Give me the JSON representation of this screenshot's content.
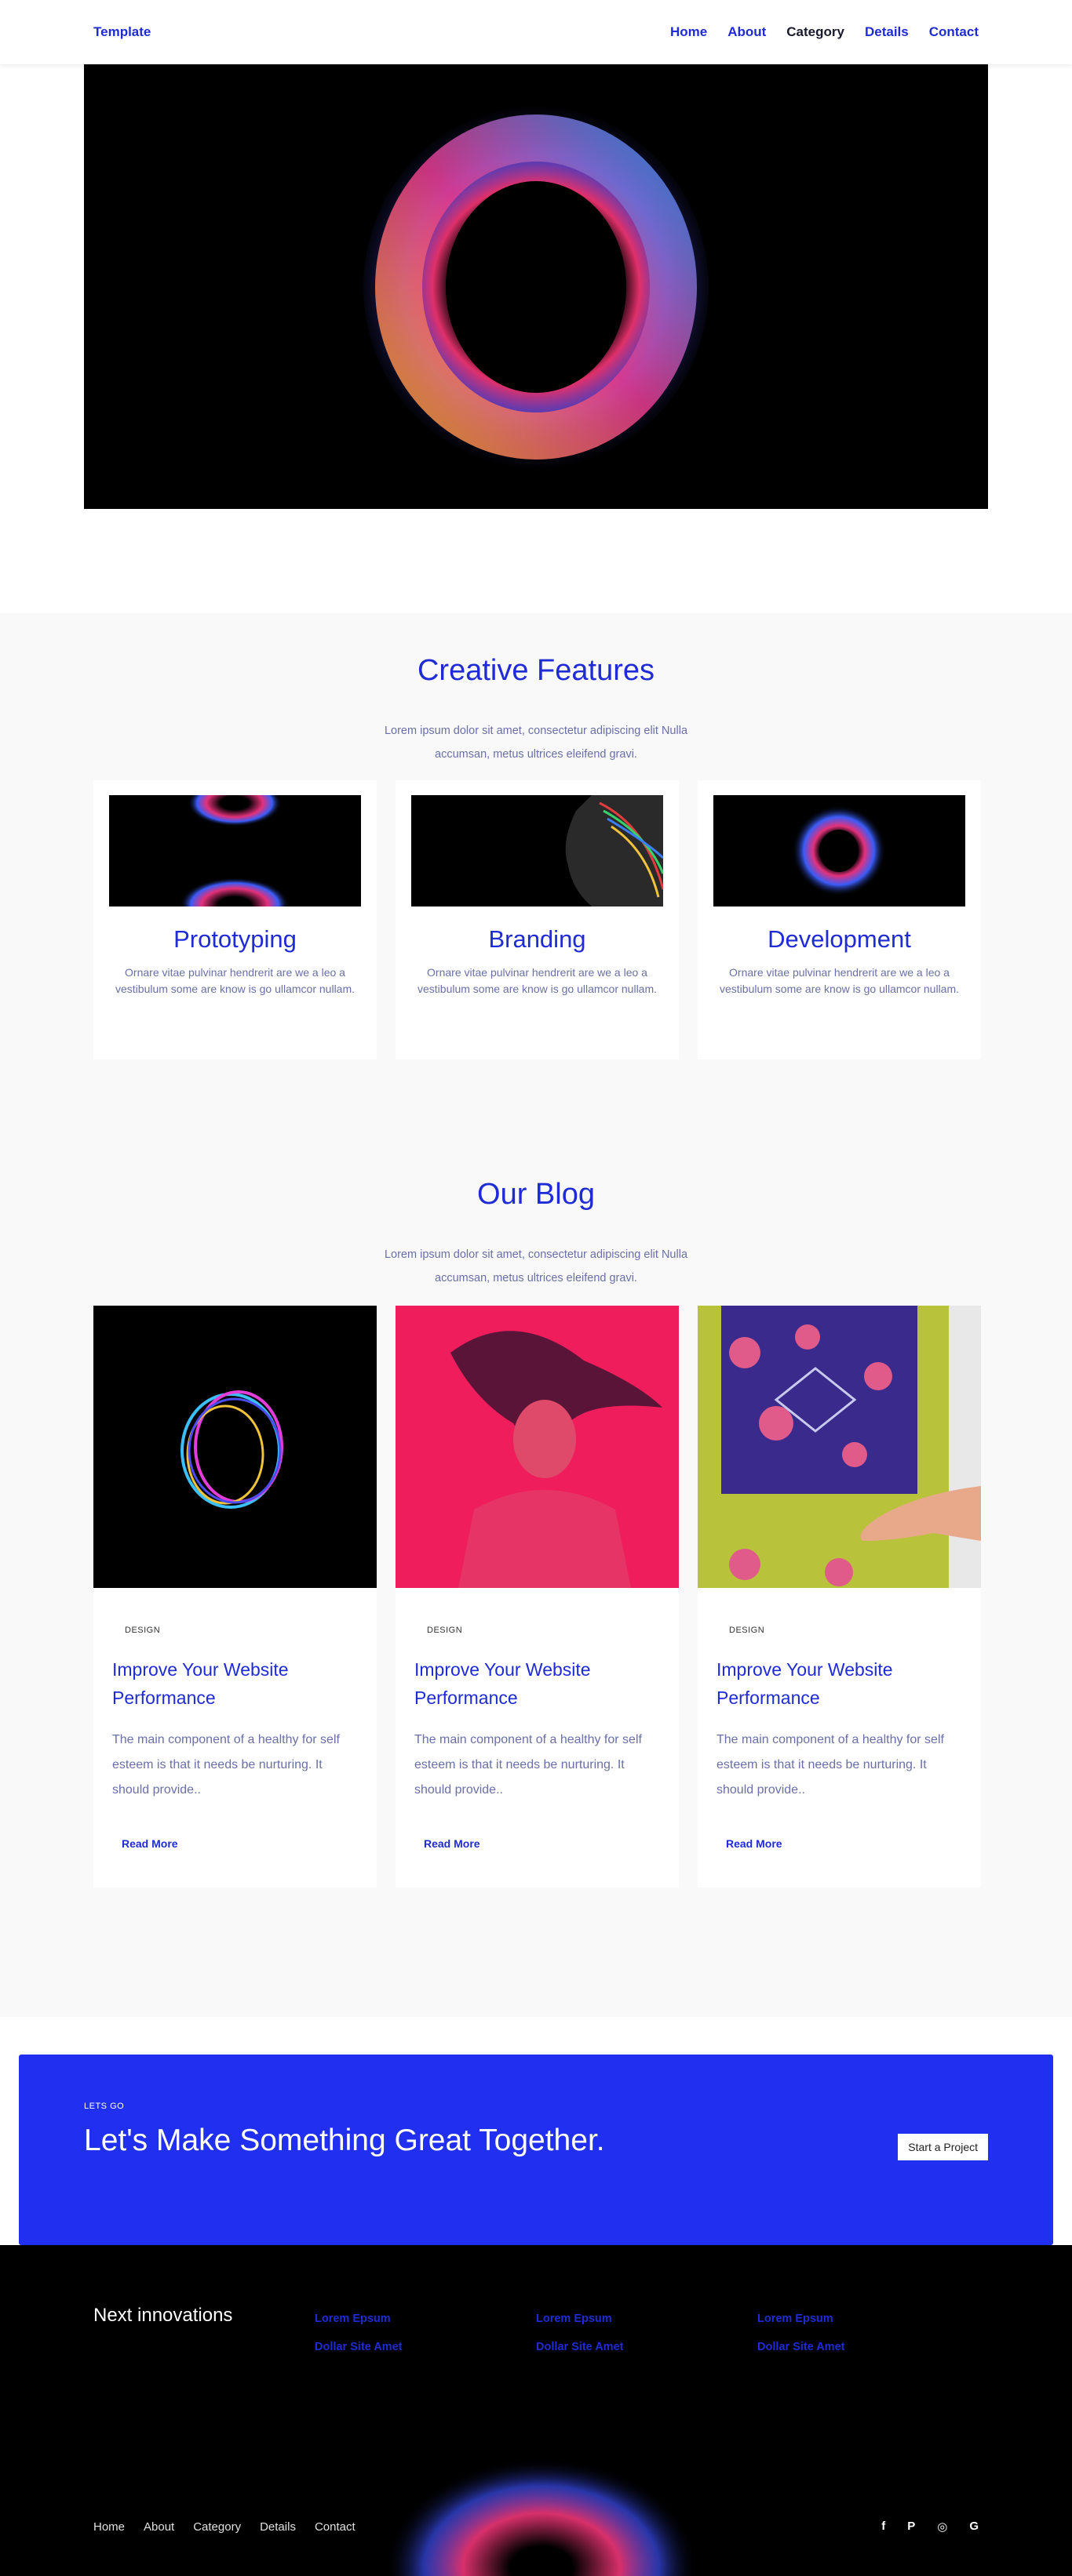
{
  "nav": {
    "brand": "Template",
    "links": [
      "Home",
      "About",
      "Category",
      "Details",
      "Contact"
    ]
  },
  "features": {
    "title": "Creative Features",
    "subtitle": "Lorem ipsum dolor sit amet, consectetur adipiscing elit Nulla accumsan, metus ultrices eleifend gravi.",
    "cards": [
      {
        "title": "Prototyping",
        "desc": "Ornare vitae pulvinar hendrerit are we a leo a vestibulum some are know is go ullamcor nullam."
      },
      {
        "title": "Branding",
        "desc": "Ornare vitae pulvinar hendrerit are we a leo a vestibulum some are know is go ullamcor nullam."
      },
      {
        "title": "Development",
        "desc": "Ornare vitae pulvinar hendrerit are we a leo a vestibulum some are know is go ullamcor nullam."
      }
    ]
  },
  "blog": {
    "title": "Our Blog",
    "subtitle": "Lorem ipsum dolor sit amet, consectetur adipiscing elit Nulla accumsan, metus ultrices eleifend gravi.",
    "posts": [
      {
        "tag": "DESIGN",
        "title": "Improve Your Website Performance",
        "text": "The main component of a healthy for self esteem is that it needs be nurturing. It should provide..",
        "link": "Read More"
      },
      {
        "tag": "DESIGN",
        "title": "Improve Your Website Performance",
        "text": "The main component of a healthy for self esteem is that it needs be nurturing. It should provide..",
        "link": "Read More"
      },
      {
        "tag": "DESIGN",
        "title": "Improve Your Website Performance",
        "text": "The main component of a healthy for self esteem is that it needs be nurturing. It should provide..",
        "link": "Read More"
      }
    ]
  },
  "cta": {
    "eyebrow": "LETS GO",
    "title": "Let's Make Something Great Together.",
    "button": "Start a Project"
  },
  "footer": {
    "brand": "Next innovations",
    "columns": [
      [
        "Lorem Epsum",
        "Dollar Site Amet"
      ],
      [
        "Lorem Epsum",
        "Dollar Site Amet"
      ],
      [
        "Lorem Epsum",
        "Dollar Site Amet"
      ]
    ],
    "links": [
      "Home",
      "About",
      "Category",
      "Details",
      "Contact"
    ],
    "socials": [
      {
        "icon": "facebook-icon",
        "glyph": "f"
      },
      {
        "icon": "pinterest-icon",
        "glyph": "P"
      },
      {
        "icon": "instagram-icon",
        "glyph": "◎"
      },
      {
        "icon": "google-icon",
        "glyph": "G"
      }
    ]
  },
  "colors": {
    "accent": "#1f2bd4",
    "cta": "#2130f0",
    "muted": "#6a6fa6"
  }
}
